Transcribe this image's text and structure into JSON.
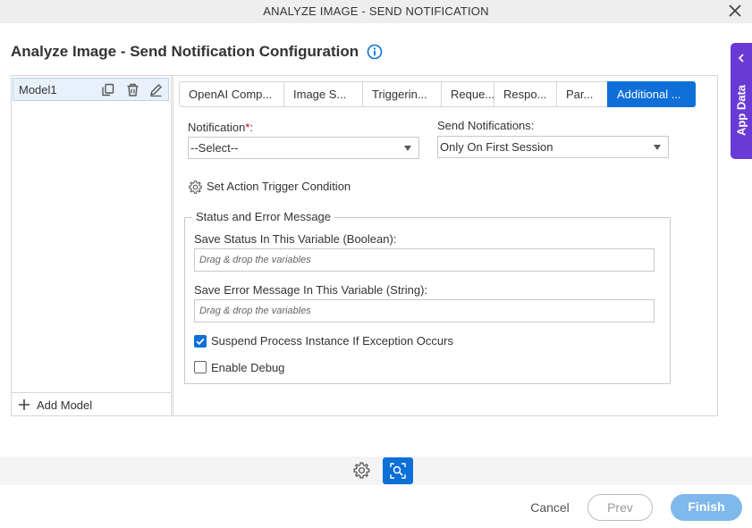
{
  "window": {
    "title": "ANALYZE IMAGE - SEND NOTIFICATION"
  },
  "header": {
    "title": "Analyze Image - Send Notification Configuration"
  },
  "models": {
    "items": [
      {
        "label": "Model1"
      }
    ],
    "add_label": "Add Model"
  },
  "tabs": [
    {
      "label": "OpenAI Comp..."
    },
    {
      "label": "Image S..."
    },
    {
      "label": "Triggerin..."
    },
    {
      "label": "Reque..."
    },
    {
      "label": "Respo..."
    },
    {
      "label": "Par..."
    },
    {
      "label": "Additional ...",
      "active": true
    }
  ],
  "form": {
    "notification_label": "Notification",
    "notification_required": "*",
    "notification_colon": ":",
    "notification_value": "--Select--",
    "send_label": "Send Notifications:",
    "send_value": "Only On First Session",
    "trigger_label": "Set Action Trigger Condition"
  },
  "status_group": {
    "legend": "Status and Error Message",
    "status_label": "Save Status In This Variable (Boolean):",
    "status_placeholder": "Drag & drop the variables",
    "error_label": "Save Error Message In This Variable (String):",
    "error_placeholder": "Drag & drop the variables",
    "suspend_label": "Suspend Process Instance If Exception Occurs",
    "suspend_checked": true,
    "debug_label": "Enable Debug",
    "debug_checked": false
  },
  "side_panel": {
    "label": "App Data"
  },
  "footer": {
    "cancel": "Cancel",
    "prev": "Prev",
    "finish": "Finish"
  },
  "colors": {
    "accent": "#0d6fd7",
    "app_data": "#6a3ad6",
    "finish": "#7fb8ea",
    "required": "#d0021b"
  },
  "icons": [
    "close-icon",
    "info-icon",
    "copy-icon",
    "trash-icon",
    "edit-icon",
    "plus-icon",
    "gear-icon",
    "checkmark-icon",
    "chevron-left-icon",
    "image-search-icon"
  ]
}
